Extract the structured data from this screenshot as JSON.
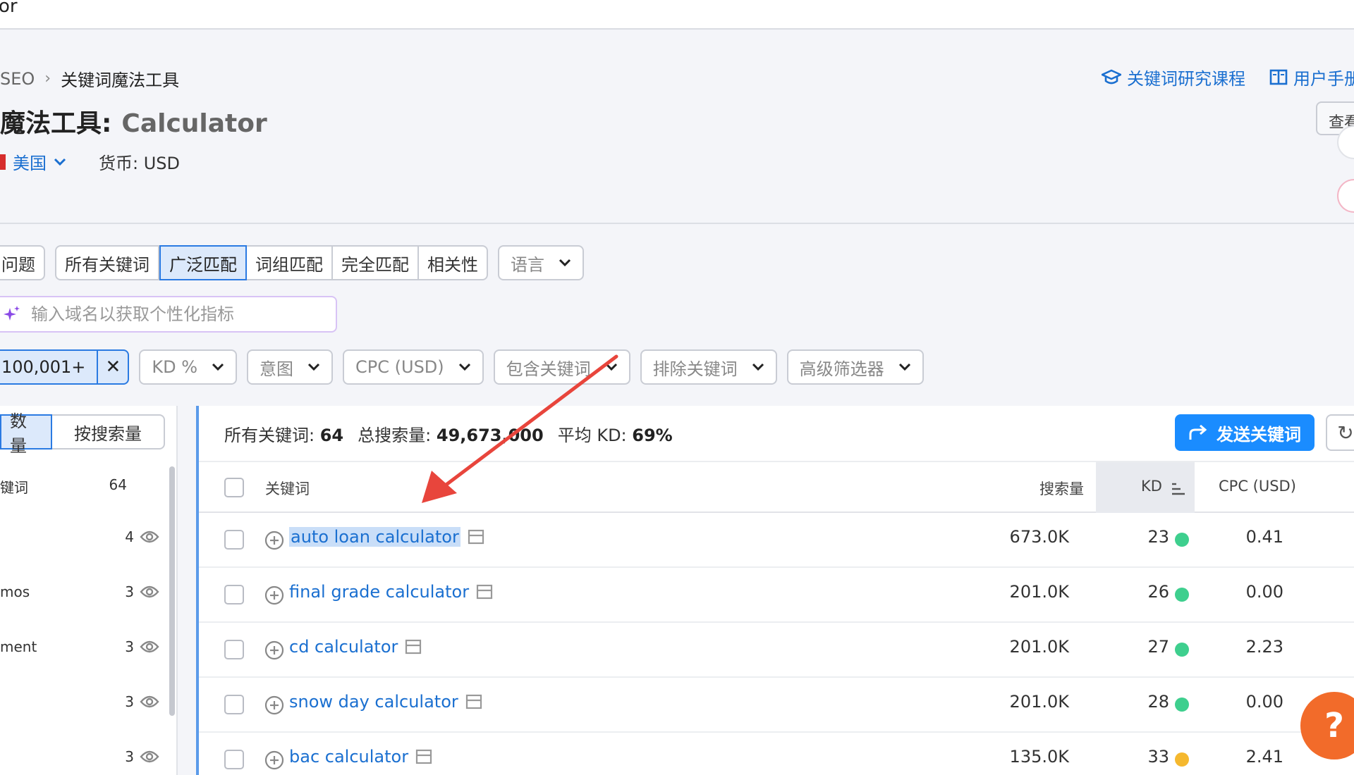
{
  "topbar": {
    "fragment": "or"
  },
  "breadcrumb": {
    "parent": "SEO",
    "current": "关键词魔法工具"
  },
  "links": {
    "course": "关键词研究课程",
    "manual": "用户手册"
  },
  "title": {
    "prefix": "魔法工具:",
    "keyword": "Calculator"
  },
  "view_button": "查看",
  "meta": {
    "country": "美国",
    "currency": "货币: USD"
  },
  "tabs": {
    "first": "问题",
    "group": [
      "所有关键词",
      "广泛匹配",
      "词组匹配",
      "完全匹配",
      "相关性"
    ],
    "active_index": 1,
    "language": "语言"
  },
  "domain_input": {
    "placeholder": "输入域名以获取个性化指标"
  },
  "filters": {
    "volume_chip": "100,001+",
    "dropdowns": [
      "KD %",
      "意图",
      "CPC (USD)",
      "包含关键词",
      "排除关键词",
      "高级筛选器"
    ]
  },
  "left_panel": {
    "toggle": [
      "数量",
      "按搜索量"
    ],
    "rows": [
      {
        "label": "键词",
        "count": "64"
      },
      {
        "label": "",
        "count": "4"
      },
      {
        "label": "mos",
        "count": "3"
      },
      {
        "label": "ment",
        "count": "3"
      },
      {
        "label": "",
        "count": "3"
      },
      {
        "label": "",
        "count": "3"
      }
    ]
  },
  "summary": {
    "all_label": "所有关键词:",
    "all_value": "64",
    "volume_label": "总搜索量:",
    "volume_value": "49,673,000",
    "kd_label": "平均 KD:",
    "kd_value": "69%"
  },
  "send_button": "发送关键词",
  "table": {
    "headers": {
      "keyword": "关键词",
      "volume": "搜索量",
      "kd": "KD",
      "cpc": "CPC (USD)"
    },
    "rows": [
      {
        "keyword": "auto loan calculator",
        "volume": "673.0K",
        "kd": "23",
        "kd_color": "#3ecf8e",
        "cpc": "0.41"
      },
      {
        "keyword": "final grade calculator",
        "volume": "201.0K",
        "kd": "26",
        "kd_color": "#3ecf8e",
        "cpc": "0.00"
      },
      {
        "keyword": "cd calculator",
        "volume": "201.0K",
        "kd": "27",
        "kd_color": "#3ecf8e",
        "cpc": "2.23"
      },
      {
        "keyword": "snow day calculator",
        "volume": "201.0K",
        "kd": "28",
        "kd_color": "#3ecf8e",
        "cpc": "0.00"
      },
      {
        "keyword": "bac calculator",
        "volume": "135.0K",
        "kd": "33",
        "kd_color": "#f5b82e",
        "cpc": "2.41"
      }
    ]
  },
  "help_button": "?",
  "colors": {
    "accent": "#1a6fd0",
    "primary_button": "#1a8cff",
    "help": "#f26b2a",
    "arrow": "#e8453c"
  }
}
